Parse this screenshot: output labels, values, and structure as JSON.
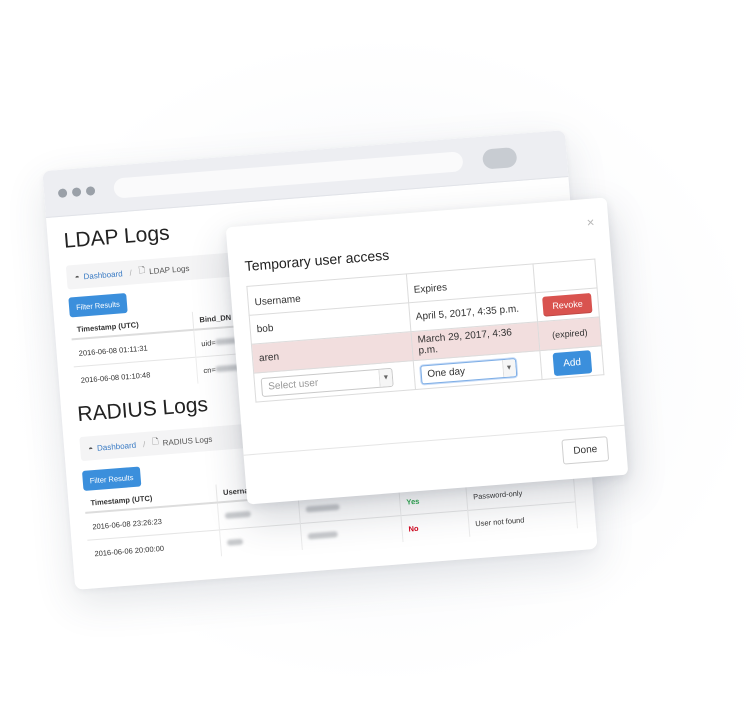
{
  "browser": {
    "ldap": {
      "title": "LDAP Logs",
      "breadcrumb": {
        "home": "Dashboard",
        "current": "LDAP Logs"
      },
      "filter_label": "Filter Results",
      "columns": [
        "Timestamp (UTC)",
        "Bind_DN"
      ],
      "rows": [
        {
          "timestamp": "2016-06-08 01:11:31",
          "bind_prefix": "uid="
        },
        {
          "timestamp": "2016-06-08 01:10:48",
          "bind_prefix": "cn="
        }
      ]
    },
    "radius": {
      "title": "RADIUS Logs",
      "breadcrumb": {
        "home": "Dashboard",
        "current": "RADIUS Logs"
      },
      "filter_label": "Filter Results",
      "columns": [
        "Timestamp (UTC)",
        "Username"
      ],
      "rows": [
        {
          "timestamp": "2016-06-08 23:26:23",
          "result": "Yes",
          "detail": "Password-only"
        },
        {
          "timestamp": "2016-06-06 20:00:00",
          "result": "No",
          "detail": "User not found"
        }
      ]
    }
  },
  "modal": {
    "title": "Temporary user access",
    "close_icon": "×",
    "columns": {
      "username": "Username",
      "expires": "Expires"
    },
    "rows": [
      {
        "username": "bob",
        "expires": "April 5, 2017, 4:35 p.m.",
        "action": "Revoke",
        "expired": false
      },
      {
        "username": "aren",
        "expires": "March 29, 2017, 4:36 p.m.",
        "action": "(expired)",
        "expired": true
      }
    ],
    "new_row": {
      "user_placeholder": "Select user",
      "duration_value": "One day",
      "add_label": "Add"
    },
    "done_label": "Done"
  },
  "colors": {
    "primary": "#3b8fdc",
    "danger": "#d9534f",
    "expired_row": "#f2dede",
    "success_text": "#2da94f",
    "error_text": "#d0021b"
  }
}
